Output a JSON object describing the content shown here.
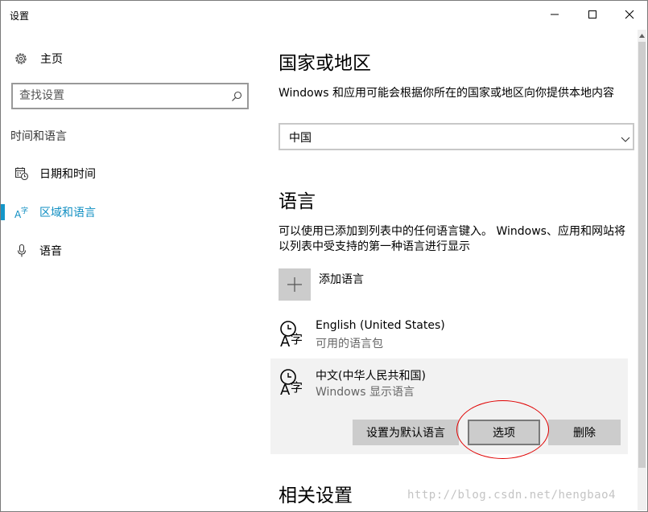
{
  "window": {
    "title": "设置"
  },
  "sidebar": {
    "home_label": "主页",
    "search_placeholder": "查找设置",
    "section_title": "时间和语言",
    "items": [
      {
        "label": "日期和时间",
        "icon": "calendar-clock-icon",
        "active": false
      },
      {
        "label": "区域和语言",
        "icon": "language-icon",
        "active": true
      },
      {
        "label": "语音",
        "icon": "microphone-icon",
        "active": false
      }
    ]
  },
  "main": {
    "region": {
      "title": "国家或地区",
      "description": "Windows 和应用可能会根据你所在的国家或地区向你提供本地内容",
      "selected_country": "中国"
    },
    "language": {
      "title": "语言",
      "description": "可以使用已添加到列表中的任何语言键入。 Windows、应用和网站将以列表中受支持的第一种语言进行显示",
      "add_label": "添加语言",
      "items": [
        {
          "name": "English (United States)",
          "status": "可用的语言包"
        },
        {
          "name": "中文(中华人民共和国)",
          "status": "Windows 显示语言"
        }
      ],
      "actions": {
        "set_default": "设置为默认语言",
        "options": "选项",
        "remove": "删除"
      }
    },
    "related": {
      "title": "相关设置"
    }
  },
  "watermark": "http://blog.csdn.net/hengbao4",
  "colors": {
    "accent": "#1496c8",
    "annotation": "#e00000"
  }
}
